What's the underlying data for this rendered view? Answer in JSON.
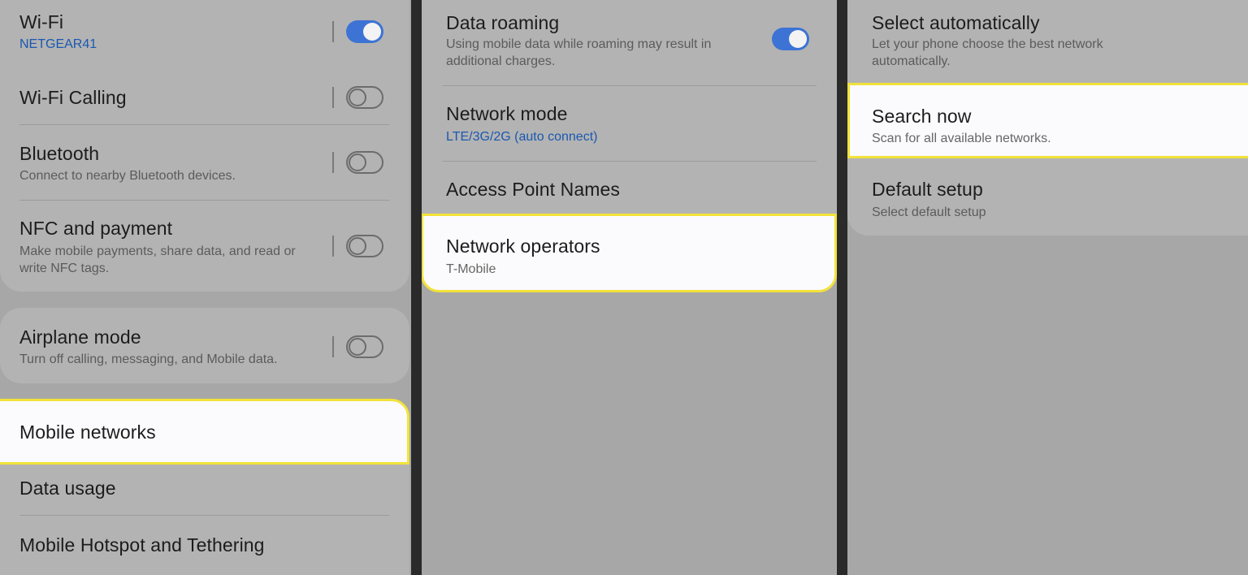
{
  "panel1": {
    "wifi": {
      "title": "Wi-Fi",
      "sub": "NETGEAR41",
      "toggle": "on"
    },
    "wifi_calling": {
      "title": "Wi-Fi Calling",
      "toggle": "off"
    },
    "bluetooth": {
      "title": "Bluetooth",
      "sub": "Connect to nearby Bluetooth devices.",
      "toggle": "off"
    },
    "nfc": {
      "title": "NFC and payment",
      "sub": "Make mobile payments, share data, and read or write NFC tags.",
      "toggle": "off"
    },
    "airplane": {
      "title": "Airplane mode",
      "sub": "Turn off calling, messaging, and Mobile data.",
      "toggle": "off"
    },
    "mobile_networks": {
      "title": "Mobile networks"
    },
    "data_usage": {
      "title": "Data usage"
    },
    "hotspot": {
      "title": "Mobile Hotspot and Tethering"
    }
  },
  "panel2": {
    "data_roaming": {
      "title": "Data roaming",
      "sub": "Using mobile data while roaming may result in additional charges.",
      "toggle": "on"
    },
    "network_mode": {
      "title": "Network mode",
      "sub": "LTE/3G/2G (auto connect)"
    },
    "apn": {
      "title": "Access Point Names"
    },
    "network_operators": {
      "title": "Network operators",
      "sub": "T-Mobile"
    }
  },
  "panel3": {
    "select_auto": {
      "title": "Select automatically",
      "sub": "Let your phone choose the best network automatically."
    },
    "search_now": {
      "title": "Search now",
      "sub": "Scan for all available networks."
    },
    "default_setup": {
      "title": "Default setup",
      "sub": "Select default setup"
    }
  },
  "colors": {
    "highlight_border": "#f2e23a",
    "toggle_on": "#3d73d4",
    "link_blue": "#1a58b0"
  }
}
